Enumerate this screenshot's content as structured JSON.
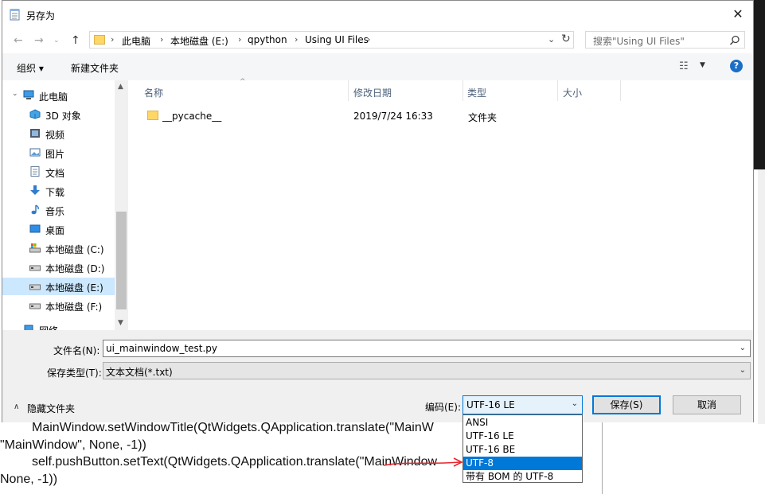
{
  "background_document": {
    "lines": [
      "MainWindow.setWindowTitle(QtWidgets.QApplication.translate(\"MainW",
      "\"MainWindow\", None, -1))",
      "self.pushButton.setText(QtWidgets.QApplication.translate(\"MainWindow",
      "None, -1))"
    ]
  },
  "dialog": {
    "title": "另存为",
    "title_icon": "notepad-icon",
    "close_icon": "close-icon"
  },
  "navbar": {
    "back_icon": "back-arrow-icon",
    "forward_icon": "forward-arrow-icon",
    "up_icon": "up-arrow-icon",
    "breadcrumbs": [
      "此电脑",
      "本地磁盘 (E:)",
      "qpython",
      "Using UI Files"
    ],
    "search_placeholder": "搜索\"Using UI Files\""
  },
  "toolbar": {
    "organize": "组织 ▾",
    "new_folder": "新建文件夹"
  },
  "nav_pane": {
    "items": [
      {
        "label": "此电脑",
        "icon": "computer-icon",
        "indent": 1
      },
      {
        "label": "3D 对象",
        "icon": "3d-objects-icon",
        "indent": 2
      },
      {
        "label": "视频",
        "icon": "video-icon",
        "indent": 2
      },
      {
        "label": "图片",
        "icon": "pictures-icon",
        "indent": 2
      },
      {
        "label": "文档",
        "icon": "documents-icon",
        "indent": 2
      },
      {
        "label": "下载",
        "icon": "download-icon",
        "indent": 2
      },
      {
        "label": "音乐",
        "icon": "music-icon",
        "indent": 2
      },
      {
        "label": "桌面",
        "icon": "desktop-icon",
        "indent": 2
      },
      {
        "label": "本地磁盘 (C:)",
        "icon": "drive-icon",
        "indent": 2
      },
      {
        "label": "本地磁盘 (D:)",
        "icon": "drive-icon",
        "indent": 2
      },
      {
        "label": "本地磁盘 (E:)",
        "icon": "drive-icon",
        "indent": 2,
        "selected": true
      },
      {
        "label": "本地磁盘 (F:)",
        "icon": "drive-icon",
        "indent": 2
      },
      {
        "label": "网络",
        "icon": "network-icon",
        "indent": 1
      }
    ]
  },
  "file_list": {
    "columns": [
      "名称",
      "修改日期",
      "类型",
      "大小"
    ],
    "rows": [
      {
        "name": "__pycache__",
        "modified": "2019/7/24 16:33",
        "type": "文件夹",
        "size": ""
      }
    ]
  },
  "form": {
    "filename_label": "文件名(N):",
    "filename_value": "ui_mainwindow_test.py",
    "filetype_label": "保存类型(T):",
    "filetype_value": "文本文档(*.txt)",
    "hide_folders_label": "隐藏文件夹",
    "encoding_label": "编码(E):",
    "encoding_value": "UTF-16 LE",
    "save_label": "保存(S)",
    "cancel_label": "取消"
  },
  "encoding_options": [
    "ANSI",
    "UTF-16 LE",
    "UTF-16 BE",
    "UTF-8",
    "带有 BOM 的 UTF-8"
  ],
  "encoding_highlighted": "UTF-8",
  "colors": {
    "accent": "#0078d7",
    "selection": "#cce8ff",
    "annotation_red": "#e8262b"
  }
}
